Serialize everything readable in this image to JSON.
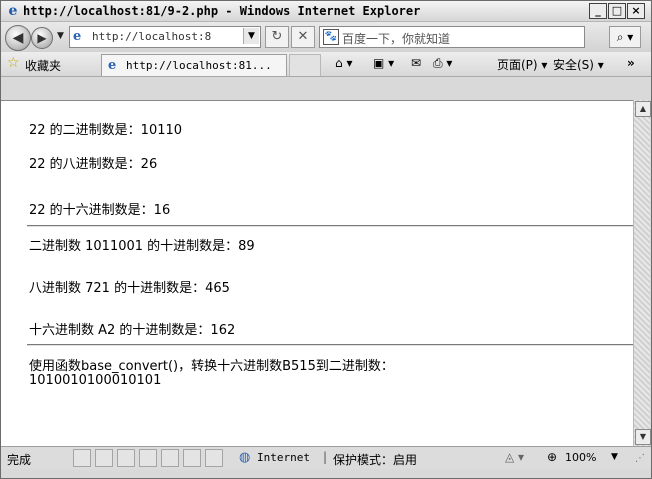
{
  "window": {
    "title": "http://localhost:81/9-2.php - Windows Internet Explorer",
    "minimize": "_",
    "maximize": "□",
    "close": "×"
  },
  "nav": {
    "address": "http://localhost:8",
    "search_placeholder": "百度一下，你就知道",
    "icons": [
      "back-icon",
      "forward-icon",
      "refresh-icon",
      "stop-icon",
      "search-icon"
    ]
  },
  "favorites": {
    "label": "收藏夹",
    "tab_title": "http://localhost:81...",
    "page_menu": "页面(P) ▾",
    "safety_menu": "安全(S) ▾",
    "more": "»"
  },
  "content": {
    "lines": [
      "22 的二进制数是：10110",
      "22 的八进制数是：26",
      "22 的十六进制数是：16",
      "二进制数 1011001 的十进制数是：89",
      "八进制数 721 的十进制数是：465",
      "十六进制数 A2 的十进制数是：162",
      "使用函数base_convert()，转换十六进制数B515到二进制数：",
      "1010010100010101"
    ]
  },
  "status": {
    "text": "完成",
    "zone": "Internet",
    "separator": "|",
    "protected_mode": "保护模式：启用",
    "zoom": "100%"
  }
}
